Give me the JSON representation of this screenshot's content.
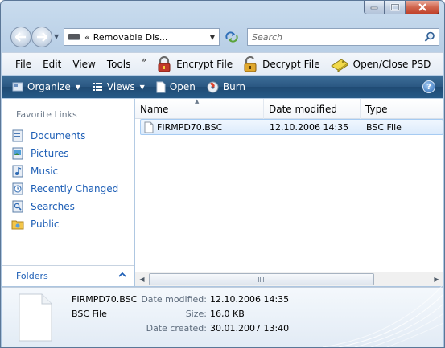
{
  "window": {
    "address": {
      "chevron": "«",
      "path": "Removable Dis..."
    },
    "search": {
      "placeholder": "Search"
    }
  },
  "menubar": {
    "items": [
      "File",
      "Edit",
      "View",
      "Tools"
    ],
    "overflow": "»",
    "extensions": [
      {
        "label": "Encrypt File",
        "icon": "lock-red-icon"
      },
      {
        "label": "Decrypt File",
        "icon": "lock-open-icon"
      },
      {
        "label": "Open/Close PSD",
        "icon": "usb-drive-icon"
      }
    ]
  },
  "commandbar": {
    "organize": "Organize",
    "views": "Views",
    "open": "Open",
    "burn": "Burn",
    "help": "?"
  },
  "navpane": {
    "favorites_title": "Favorite Links",
    "favorites": [
      {
        "label": "Documents",
        "icon": "documents-icon"
      },
      {
        "label": "Pictures",
        "icon": "pictures-icon"
      },
      {
        "label": "Music",
        "icon": "music-icon"
      },
      {
        "label": "Recently Changed",
        "icon": "recently-changed-icon"
      },
      {
        "label": "Searches",
        "icon": "searches-icon"
      },
      {
        "label": "Public",
        "icon": "public-folder-icon"
      }
    ],
    "folders_label": "Folders"
  },
  "filelist": {
    "columns": [
      "Name",
      "Date modified",
      "Type"
    ],
    "rows": [
      {
        "name": "FIRMPD70.BSC",
        "date_modified": "12.10.2006 14:35",
        "type": "BSC File",
        "selected": true
      }
    ]
  },
  "details": {
    "name": "FIRMPD70.BSC",
    "type": "BSC File",
    "fields": [
      {
        "label": "Date modified:",
        "value": "12.10.2006 14:35"
      },
      {
        "label": "Size:",
        "value": "16,0 KB"
      },
      {
        "label": "Date created:",
        "value": "30.01.2007 13:40"
      }
    ]
  },
  "colors": {
    "link": "#1e5fb6",
    "commandbar": "#2a5782",
    "selection": "#dcebfc"
  }
}
